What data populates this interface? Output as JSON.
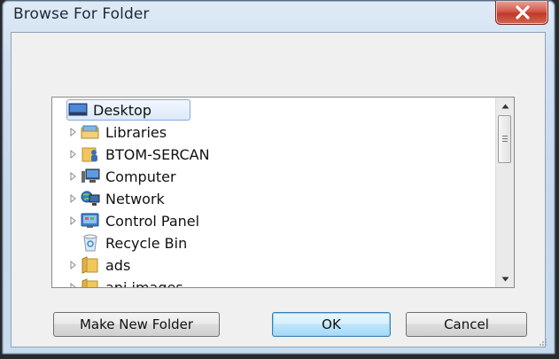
{
  "window": {
    "title": "Browse For Folder"
  },
  "tree": {
    "items": [
      {
        "label": "Desktop",
        "icon": "desktop-icon",
        "expandable": false,
        "selected": true
      },
      {
        "label": "Libraries",
        "icon": "libraries-icon",
        "expandable": true
      },
      {
        "label": "BTOM-SERCAN",
        "icon": "user-folder-icon",
        "expandable": true
      },
      {
        "label": "Computer",
        "icon": "computer-icon",
        "expandable": true
      },
      {
        "label": "Network",
        "icon": "network-icon",
        "expandable": true
      },
      {
        "label": "Control Panel",
        "icon": "control-panel-icon",
        "expandable": true
      },
      {
        "label": "Recycle Bin",
        "icon": "recycle-bin-icon",
        "expandable": false
      },
      {
        "label": "ads",
        "icon": "folder-icon",
        "expandable": true
      },
      {
        "label": "api images",
        "icon": "folder-icon",
        "expandable": true
      }
    ]
  },
  "buttons": {
    "make_new_folder": "Make New Folder",
    "ok": "OK",
    "cancel": "Cancel"
  },
  "colors": {
    "close_button": "#c0392b",
    "selection_border": "#84acdd",
    "folder_yellow": "#f1c75c"
  }
}
